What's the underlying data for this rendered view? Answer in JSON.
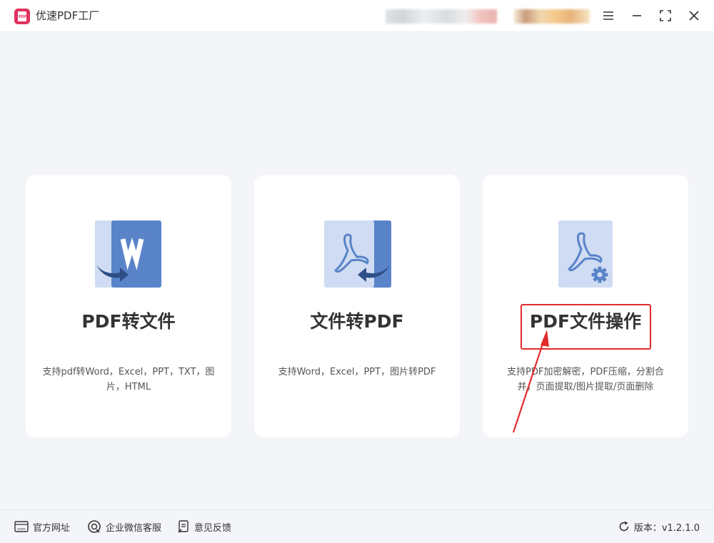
{
  "app": {
    "title": "优速PDF工厂",
    "logo_text": "PDF"
  },
  "window_controls": [
    "menu-icon",
    "minimize-icon",
    "maximize-icon",
    "close-icon"
  ],
  "cards": [
    {
      "title": "PDF转文件",
      "description": "支持pdf转Word，Excel，PPT，TXT，图片，HTML",
      "icon": "pdf-to-word-icon"
    },
    {
      "title": "文件转PDF",
      "description": "支持Word，Excel，PPT，图片转PDF",
      "icon": "file-to-pdf-icon"
    },
    {
      "title": "PDF文件操作",
      "description": "支持PDF加密解密，PDF压缩，分割合并，页面提取/图片提取/页面删除",
      "icon": "pdf-settings-icon"
    }
  ],
  "footer": {
    "links": [
      {
        "label": "官方网址",
        "icon": "website-icon"
      },
      {
        "label": "企业微信客服",
        "icon": "support-icon"
      },
      {
        "label": "意见反馈",
        "icon": "feedback-icon"
      }
    ],
    "version_text": "版本：v1.2.1.0"
  },
  "colors": {
    "background": "#f4f5f8",
    "card": "#ffffff",
    "icon_dark": "#5a84c9",
    "icon_light": "#d0dcf3",
    "arrow": "#2d4f86",
    "annotation": "#e32b2b",
    "logo": "#e0315f"
  }
}
